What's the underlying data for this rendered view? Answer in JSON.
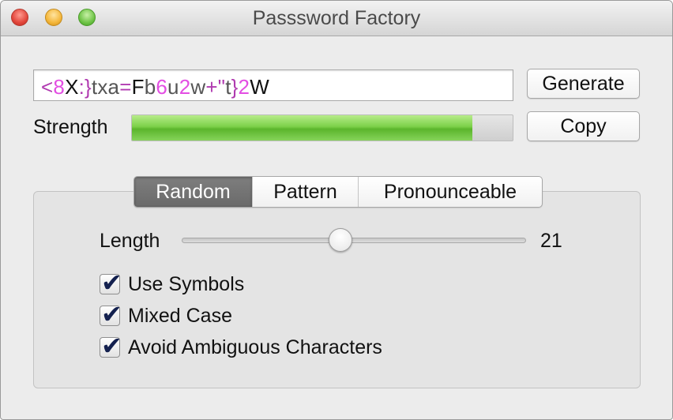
{
  "window": {
    "title": "Passsword Factory"
  },
  "password": {
    "segments": [
      {
        "text": "<",
        "color": "#b03ab0"
      },
      {
        "text": "8",
        "color": "#e34ee3"
      },
      {
        "text": "X",
        "color": "#111111"
      },
      {
        "text": ":}",
        "color": "#b03ab0"
      },
      {
        "text": "txa",
        "color": "#555555"
      },
      {
        "text": "=",
        "color": "#b03ab0"
      },
      {
        "text": "F",
        "color": "#111111"
      },
      {
        "text": "b",
        "color": "#555555"
      },
      {
        "text": "6",
        "color": "#e34ee3"
      },
      {
        "text": "u",
        "color": "#555555"
      },
      {
        "text": "2",
        "color": "#e34ee3"
      },
      {
        "text": "w",
        "color": "#555555"
      },
      {
        "text": "+\"",
        "color": "#b03ab0"
      },
      {
        "text": "t",
        "color": "#555555"
      },
      {
        "text": "}",
        "color": "#b03ab0"
      },
      {
        "text": "2",
        "color": "#e34ee3"
      },
      {
        "text": "W",
        "color": "#111111"
      }
    ]
  },
  "buttons": {
    "generate": "Generate",
    "copy": "Copy"
  },
  "strength": {
    "label": "Strength",
    "fraction": 0.894
  },
  "tabs": [
    {
      "label": "Random",
      "selected": true
    },
    {
      "label": "Pattern",
      "selected": false
    },
    {
      "label": "Pronounceable",
      "selected": false
    }
  ],
  "length": {
    "label": "Length",
    "value": "21",
    "slider_fraction": 0.46
  },
  "options": [
    {
      "label": "Use Symbols",
      "checked": true
    },
    {
      "label": "Mixed Case",
      "checked": true
    },
    {
      "label": "Avoid Ambiguous Characters",
      "checked": true
    }
  ]
}
